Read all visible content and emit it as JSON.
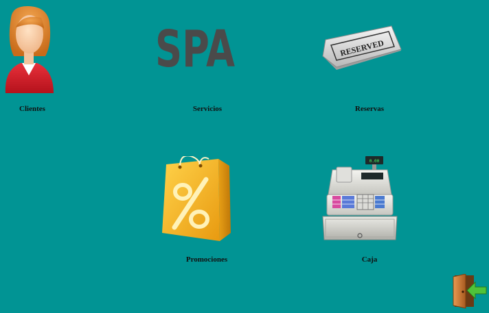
{
  "menu": {
    "clientes": {
      "label": "Clientes",
      "icon": "customer-woman-icon"
    },
    "servicios": {
      "label": "Servicios",
      "icon": "spa-text-icon",
      "logo_text": "SPA"
    },
    "reservas": {
      "label": "Reservas",
      "icon": "reserved-sign-icon",
      "sign_text": "RESERVED"
    },
    "promociones": {
      "label": "Promociones",
      "icon": "discount-bag-icon"
    },
    "caja": {
      "label": "Caja",
      "icon": "cash-register-icon"
    }
  },
  "exit": {
    "icon": "exit-door-icon"
  },
  "colors": {
    "background": "#019494",
    "spa_text": "#4a4a4a",
    "bag": "#f2b01e",
    "door": "#c97a3a",
    "arrow": "#4fc33a"
  }
}
